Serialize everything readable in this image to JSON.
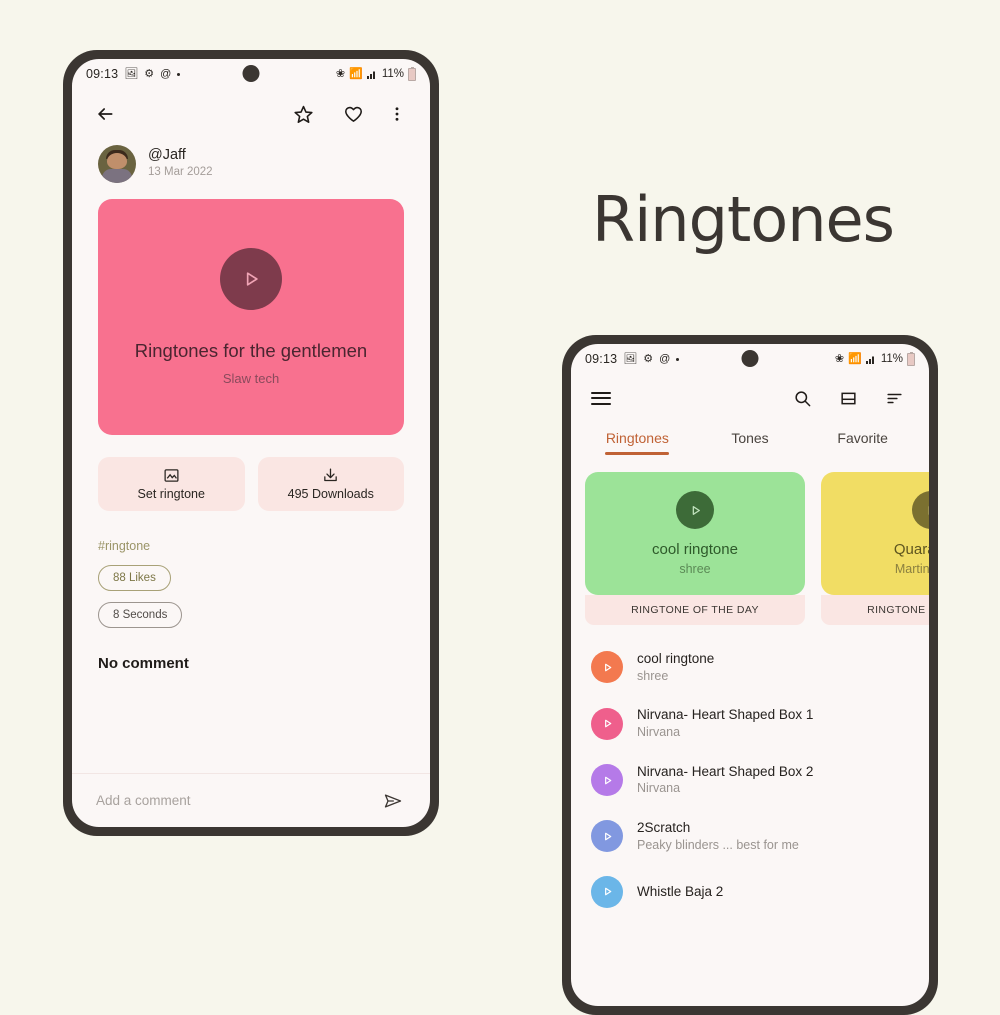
{
  "page": {
    "background_color": "#f7f6ec",
    "big_title": "Ringtones"
  },
  "phone_left": {
    "statusbar": {
      "time": "09:13",
      "icons": [
        "photo-icon",
        "gear-icon",
        "at-icon",
        "dot-icon"
      ],
      "bluetooth": "bluetooth-icon",
      "wifi": "wifi-icon",
      "signal": "signal-icon",
      "battery_text": "11%"
    },
    "appbar": {
      "back": "arrow-left-icon",
      "star": "star-icon",
      "heart": "heart-icon",
      "overflow": "more-vertical-icon"
    },
    "author": {
      "name": "@Jaff",
      "date": "13 Mar 2022"
    },
    "hero": {
      "title": "Ringtones for the gentlemen",
      "subtitle": "Slaw tech",
      "bg_color": "#f8718f",
      "play_color": "#7e3b4c"
    },
    "actions": [
      {
        "label": "Set ringtone",
        "icon": "image-icon"
      },
      {
        "label": "495 Downloads",
        "icon": "download-icon"
      }
    ],
    "hashtag": "#ringtone",
    "chips": [
      {
        "label": "88 Likes",
        "style": "olive"
      },
      {
        "label": "8 Seconds",
        "style": "neutral"
      }
    ],
    "comments": {
      "empty_text": "No comment",
      "input_placeholder": "Add a comment",
      "input_value": "",
      "send_icon": "send-icon"
    }
  },
  "phone_right": {
    "statusbar": {
      "time": "09:13",
      "battery_text": "11%"
    },
    "appbar": {
      "menu": "hamburger-icon",
      "search": "search-icon",
      "layout": "view-list-icon",
      "sort": "sort-icon"
    },
    "tabs": [
      {
        "label": "Ringtones",
        "active": true
      },
      {
        "label": "Tones",
        "active": false
      },
      {
        "label": "Favorite",
        "active": false
      }
    ],
    "featured": [
      {
        "title": "cool ringtone",
        "subtitle": "shree",
        "footer": "RINGTONE OF THE DAY",
        "bg_color": "#9ce398",
        "play_color": "#3d6b38",
        "title_color": "#2e5a2a",
        "sub_color": "#5b8a56"
      },
      {
        "title": "Quarantine",
        "subtitle": "Martin Garrix",
        "footer": "RINGTONE OF THE DAY",
        "bg_color": "#f1dd64",
        "play_color": "#7b7030",
        "title_color": "#5e551f",
        "sub_color": "#8b8040"
      }
    ],
    "list": [
      {
        "title": "cool ringtone",
        "subtitle": "shree",
        "color": "#f3794f"
      },
      {
        "title": "Nirvana- Heart Shaped Box 1",
        "subtitle": "Nirvana",
        "color": "#ef5f8c"
      },
      {
        "title": "Nirvana- Heart Shaped Box 2",
        "subtitle": "Nirvana",
        "color": "#b57ae8"
      },
      {
        "title": "2Scratch",
        "subtitle": "Peaky blinders ... best for me",
        "color": "#8198e0"
      },
      {
        "title": "Whistle Baja 2",
        "subtitle": "",
        "color": "#6bb6e8"
      }
    ]
  }
}
